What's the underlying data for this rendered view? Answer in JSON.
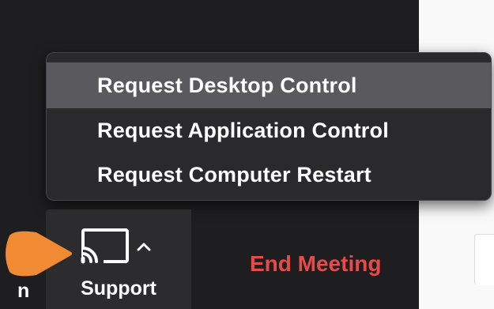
{
  "menu": {
    "items": [
      {
        "label": "Request Desktop Control",
        "highlighted": true
      },
      {
        "label": "Request Application Control",
        "highlighted": false
      },
      {
        "label": "Request Computer Restart",
        "highlighted": false
      }
    ]
  },
  "toolbar": {
    "partial_left_label": "n",
    "support_label": "Support",
    "end_meeting_label": "End Meeting",
    "share_icon": "screen-share-icon",
    "caret_icon": "caret-up-icon",
    "pointer_icon": "callout-pointer-icon"
  },
  "colors": {
    "toolbar_bg": "#1e1e20",
    "menu_bg": "#2a2a2c",
    "menu_highlight": "#5a5a5e",
    "end_meeting": "#e84a4a",
    "pointer_orange": "#f08a33"
  }
}
